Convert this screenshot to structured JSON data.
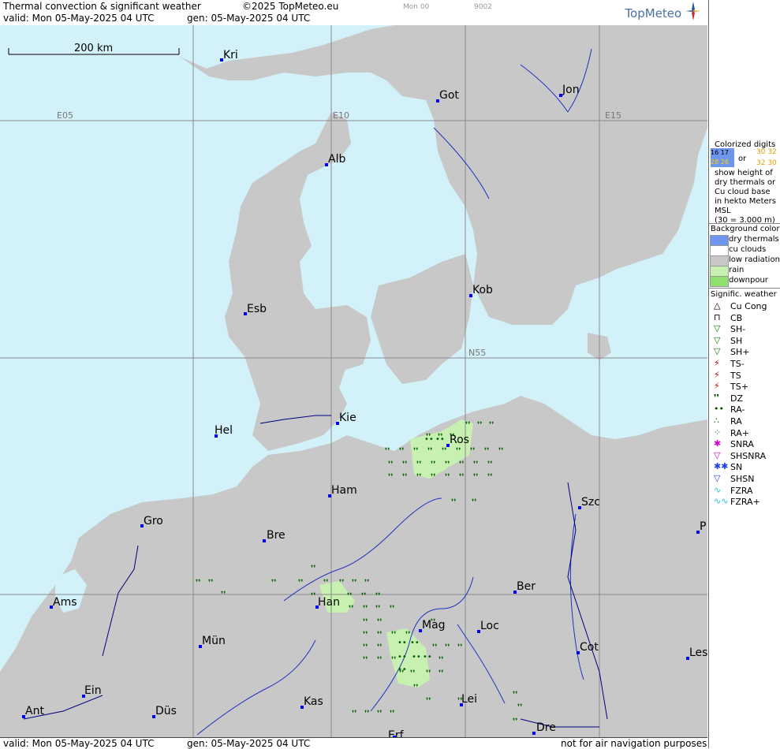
{
  "header": {
    "title": "Thermal convection & significant weather",
    "copyright": "©2025 TopMeteo.eu",
    "valid": "valid:  Mon  05-May-2025  04 UTC",
    "gen": "gen: 05-May-2025 04 UTC",
    "code1": "Mon 00",
    "code2": "9002",
    "brand": "TopMeteo"
  },
  "footer": {
    "valid": "valid:  Mon  05-May-2025  04 UTC",
    "gen": "gen: 05-May-2025 04 UTC",
    "disclaimer": "not for air navigation purposes"
  },
  "map": {
    "scale_label": "200 km",
    "grid_labels": {
      "e05": "E05",
      "e10": "E10",
      "e15": "E15",
      "n55": "N55"
    },
    "colors": {
      "sea": "#d3f1f9",
      "land": "#c8c8c8",
      "rain": "#c8f0b0",
      "border": "#000080",
      "river": "#2030c0",
      "city": "#0000ff"
    },
    "cities": [
      {
        "id": "kri",
        "name": "Kri"
      },
      {
        "id": "got",
        "name": "Got"
      },
      {
        "id": "jon",
        "name": "Jon"
      },
      {
        "id": "alb",
        "name": "Alb"
      },
      {
        "id": "kob",
        "name": "Kob"
      },
      {
        "id": "esb",
        "name": "Esb"
      },
      {
        "id": "kie",
        "name": "Kie"
      },
      {
        "id": "hel",
        "name": "Hel"
      },
      {
        "id": "ros",
        "name": "Ros"
      },
      {
        "id": "ham",
        "name": "Ham"
      },
      {
        "id": "szc",
        "name": "Szc"
      },
      {
        "id": "gro",
        "name": "Gro"
      },
      {
        "id": "bre",
        "name": "Bre"
      },
      {
        "id": "p",
        "name": "P"
      },
      {
        "id": "ber",
        "name": "Ber"
      },
      {
        "id": "ams",
        "name": "Ams"
      },
      {
        "id": "han",
        "name": "Han"
      },
      {
        "id": "mag",
        "name": "Mag"
      },
      {
        "id": "loc",
        "name": "Loc"
      },
      {
        "id": "mun",
        "name": "Mün"
      },
      {
        "id": "cot",
        "name": "Cot"
      },
      {
        "id": "les",
        "name": "Les"
      },
      {
        "id": "ein",
        "name": "Ein"
      },
      {
        "id": "kas",
        "name": "Kas"
      },
      {
        "id": "lei",
        "name": "Lei"
      },
      {
        "id": "ant",
        "name": "Ant"
      },
      {
        "id": "dus",
        "name": "Düs"
      },
      {
        "id": "dre",
        "name": "Dre"
      },
      {
        "id": "erf",
        "name": "Erf"
      }
    ]
  },
  "legend": {
    "colorized_title": "Colorized digits",
    "or": "or",
    "digits_a1": "16 17",
    "digits_a2": "28 26",
    "digits_b1": "30 32",
    "digits_b2": "32 30",
    "desc1": "show height of",
    "desc2": "dry thermals or",
    "desc3": "Cu cloud base",
    "desc4": "in hekto Meters",
    "desc5": "MSL",
    "desc6": "(30 = 3.000 m)",
    "bg_title": "Background color",
    "bg_items": [
      {
        "label": "dry thermals",
        "color": "#6e96ee"
      },
      {
        "label": "cu clouds",
        "color": "#ffffff"
      },
      {
        "label": "low radiation",
        "color": "#c8c8c8"
      },
      {
        "label": "rain",
        "color": "#c8f0b0"
      },
      {
        "label": "downpour",
        "color": "#90e070"
      }
    ],
    "wx_title": "Signific. weather",
    "wx_items": [
      {
        "label": "Cu Cong",
        "sym": "△",
        "color": "#000000"
      },
      {
        "label": "CB",
        "sym": "⊓",
        "color": "#000000"
      },
      {
        "label": "SH-",
        "sym": "▽",
        "color": "#008000"
      },
      {
        "label": "SH",
        "sym": "▽",
        "color": "#008000"
      },
      {
        "label": "SH+",
        "sym": "▽",
        "color": "#008000"
      },
      {
        "label": "TS-",
        "sym": "⚡",
        "color": "#c00000"
      },
      {
        "label": "TS",
        "sym": "⚡",
        "color": "#c00000"
      },
      {
        "label": "TS+",
        "sym": "⚡",
        "color": "#c00000"
      },
      {
        "label": "DZ",
        "sym": "❜❜",
        "color": "#005000"
      },
      {
        "label": "RA-",
        "sym": "••",
        "color": "#005000"
      },
      {
        "label": "RA",
        "sym": "∴",
        "color": "#005000"
      },
      {
        "label": "RA+",
        "sym": "⁘",
        "color": "#005000"
      },
      {
        "label": "SNRA",
        "sym": "✱",
        "color": "#d000d0"
      },
      {
        "label": "SHSNRA",
        "sym": "▽",
        "color": "#d000d0"
      },
      {
        "label": "SN",
        "sym": "✱✱",
        "color": "#2040e0"
      },
      {
        "label": "SHSN",
        "sym": "▽",
        "color": "#2040e0"
      },
      {
        "label": "FZRA",
        "sym": "∿",
        "color": "#20c0e0"
      },
      {
        "label": "FZRA+",
        "sym": "∿∿",
        "color": "#20c0e0"
      }
    ]
  }
}
